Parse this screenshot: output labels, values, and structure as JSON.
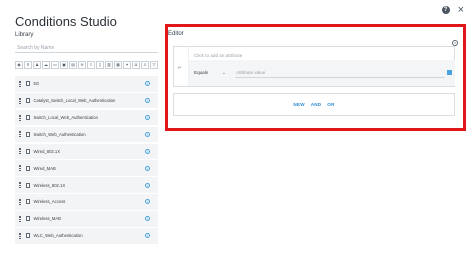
{
  "header": {
    "title": "Conditions Studio",
    "help_glyph": "?",
    "close_glyph": "×"
  },
  "library": {
    "heading": "Library",
    "search_placeholder": "Search by Name",
    "toolbar_icons": [
      "location-icon",
      "network-icon",
      "user-icon",
      "cloud-icon",
      "computer-icon",
      "monitor-icon",
      "id-card-icon",
      "wifi-icon",
      "sliders-icon",
      "document-icon",
      "clipboard-icon",
      "grid-icon",
      "settings-icon",
      "lock-icon",
      "user-tag-icon",
      "filter-icon"
    ],
    "items": [
      {
        "label": "5G"
      },
      {
        "label": "Catalyst_Switch_Local_Web_Authentication"
      },
      {
        "label": "Switch_Local_Web_Authentication"
      },
      {
        "label": "Switch_Web_Authentication"
      },
      {
        "label": "Wired_802.1X"
      },
      {
        "label": "Wired_MAB"
      },
      {
        "label": "Wireless_802.1X"
      },
      {
        "label": "Wireless_Access"
      },
      {
        "label": "Wireless_MAB"
      },
      {
        "label": "WLC_Web_Authentication"
      }
    ]
  },
  "editor": {
    "heading": "Editor",
    "attribute_placeholder": "Click to add an attribute",
    "operator_value": "Equals",
    "value_placeholder": "Attribute value",
    "buttons": {
      "new": "NEW",
      "and": "AND",
      "or": "OR"
    },
    "highlight_color": "#e0161b"
  }
}
